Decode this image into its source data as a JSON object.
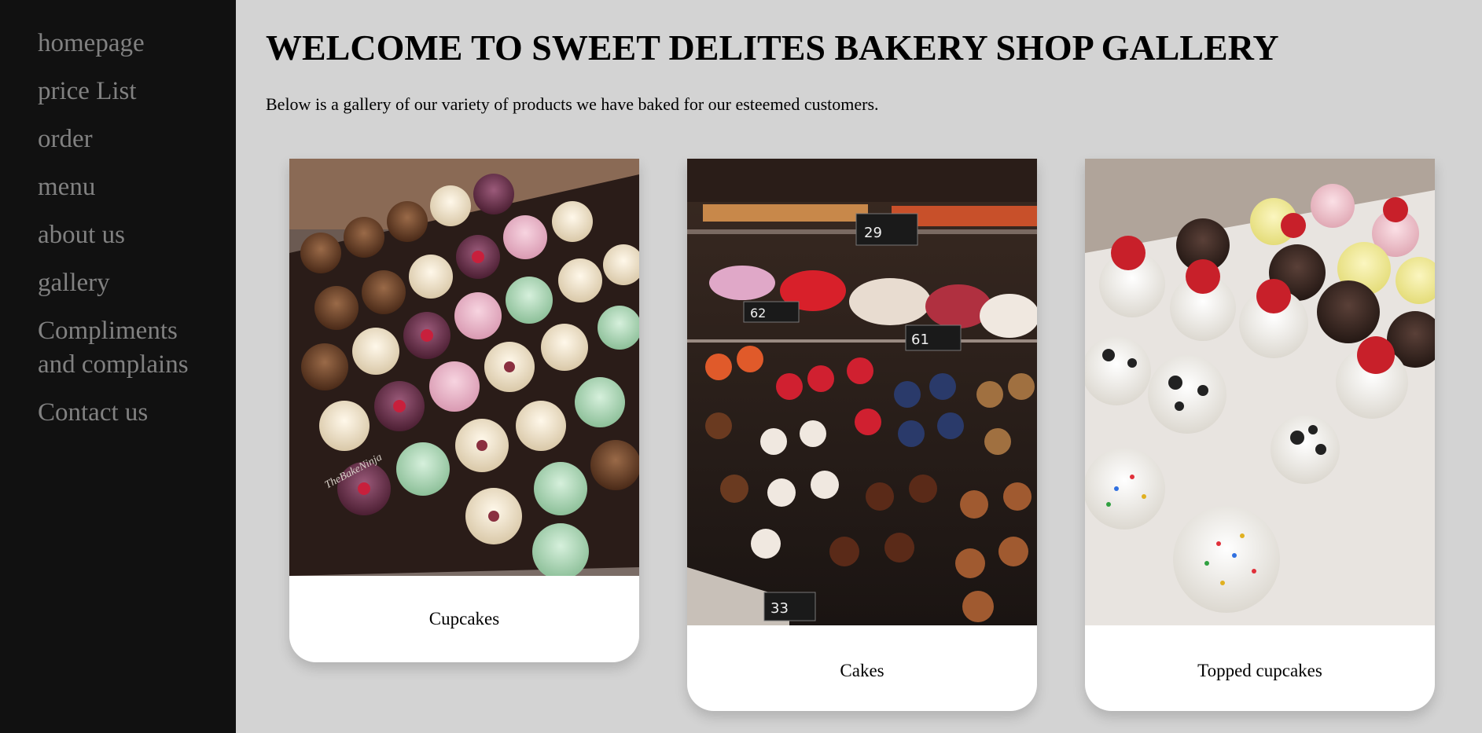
{
  "sidebar": {
    "items": [
      {
        "label": "homepage"
      },
      {
        "label": "price List"
      },
      {
        "label": "order"
      },
      {
        "label": "menu"
      },
      {
        "label": "about us"
      },
      {
        "label": "gallery"
      },
      {
        "label": "Compliments and complains"
      },
      {
        "label": "Contact us"
      }
    ]
  },
  "main": {
    "title": "WELCOME TO SWEET DELITES BAKERY SHOP GALLERY",
    "intro": "Below is a gallery of our variety of products we have baked for our esteemed customers.",
    "gallery": [
      {
        "caption": "Cupcakes",
        "watermark": "TheBakeNinja"
      },
      {
        "caption": "Cakes",
        "price_tags": [
          "29",
          "62",
          "61",
          "33"
        ]
      },
      {
        "caption": "Topped cupcakes"
      }
    ]
  },
  "colors": {
    "sidebar_bg": "#111111",
    "nav_text": "#818181",
    "page_bg": "#d3d3d3",
    "card_bg": "#ffffff"
  }
}
